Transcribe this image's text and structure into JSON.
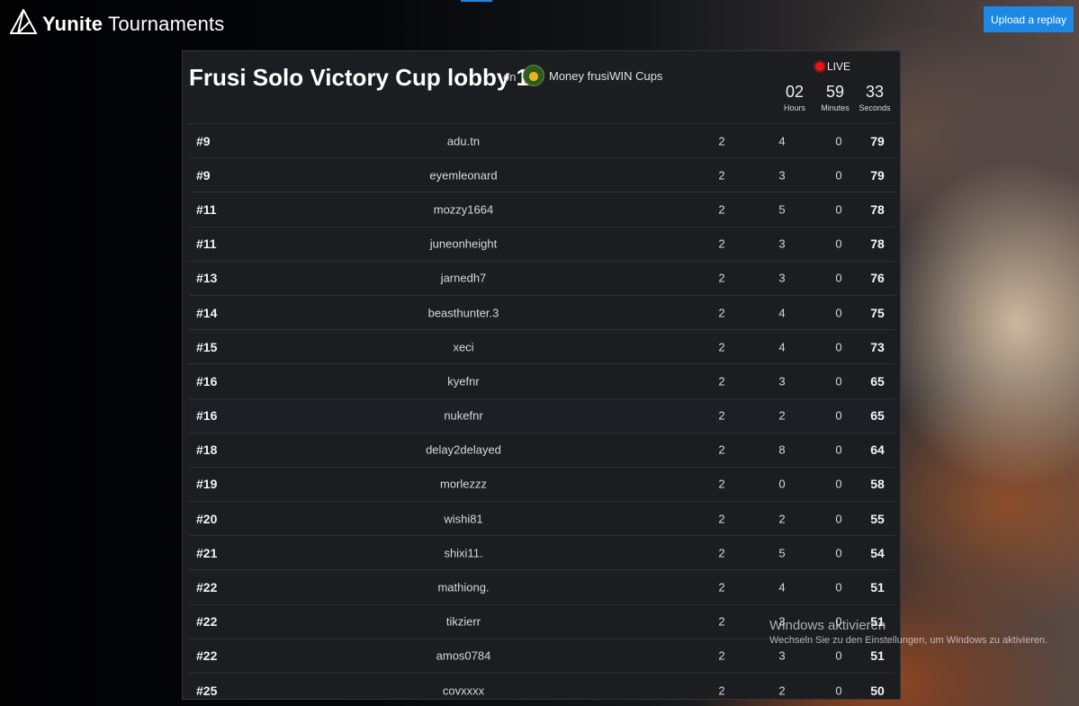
{
  "header": {
    "brand_bold": "Yunite",
    "brand_rest": " Tournaments",
    "upload_label": "Upload a replay"
  },
  "tournament": {
    "title": "Frusi Solo Victory Cup lobby 1",
    "on_label": "on",
    "organizer": "Money frusiWIN Cups",
    "live_label": "LIVE",
    "timer": [
      {
        "value": "02",
        "unit": "Hours"
      },
      {
        "value": "59",
        "unit": "Minutes"
      },
      {
        "value": "33",
        "unit": "Seconds"
      }
    ]
  },
  "leaderboard": [
    {
      "rank": "#9",
      "name": "adu.tn",
      "c1": "2",
      "c2": "4",
      "c3": "0",
      "points": "79"
    },
    {
      "rank": "#9",
      "name": "eyemleonard",
      "c1": "2",
      "c2": "3",
      "c3": "0",
      "points": "79"
    },
    {
      "rank": "#11",
      "name": "mozzy1664",
      "c1": "2",
      "c2": "5",
      "c3": "0",
      "points": "78"
    },
    {
      "rank": "#11",
      "name": "juneonheight",
      "c1": "2",
      "c2": "3",
      "c3": "0",
      "points": "78"
    },
    {
      "rank": "#13",
      "name": "jarnedh7",
      "c1": "2",
      "c2": "3",
      "c3": "0",
      "points": "76"
    },
    {
      "rank": "#14",
      "name": "beasthunter.3",
      "c1": "2",
      "c2": "4",
      "c3": "0",
      "points": "75"
    },
    {
      "rank": "#15",
      "name": "xeci",
      "c1": "2",
      "c2": "4",
      "c3": "0",
      "points": "73"
    },
    {
      "rank": "#16",
      "name": "kyefnr",
      "c1": "2",
      "c2": "3",
      "c3": "0",
      "points": "65"
    },
    {
      "rank": "#16",
      "name": "nukefnr",
      "c1": "2",
      "c2": "2",
      "c3": "0",
      "points": "65"
    },
    {
      "rank": "#18",
      "name": "delay2delayed",
      "c1": "2",
      "c2": "8",
      "c3": "0",
      "points": "64"
    },
    {
      "rank": "#19",
      "name": "morlezzz",
      "c1": "2",
      "c2": "0",
      "c3": "0",
      "points": "58"
    },
    {
      "rank": "#20",
      "name": "wishi81",
      "c1": "2",
      "c2": "2",
      "c3": "0",
      "points": "55"
    },
    {
      "rank": "#21",
      "name": "shixi11.",
      "c1": "2",
      "c2": "5",
      "c3": "0",
      "points": "54"
    },
    {
      "rank": "#22",
      "name": "mathiong.",
      "c1": "2",
      "c2": "4",
      "c3": "0",
      "points": "51"
    },
    {
      "rank": "#22",
      "name": "tikzierr",
      "c1": "2",
      "c2": "3",
      "c3": "0",
      "points": "51"
    },
    {
      "rank": "#22",
      "name": "amos0784",
      "c1": "2",
      "c2": "3",
      "c3": "0",
      "points": "51"
    },
    {
      "rank": "#25",
      "name": "covxxxx",
      "c1": "2",
      "c2": "2",
      "c3": "0",
      "points": "50"
    }
  ],
  "watermark": {
    "title": "Windows aktivieren",
    "subtitle": "Wechseln Sie zu den Einstellungen, um Windows zu aktivieren."
  }
}
